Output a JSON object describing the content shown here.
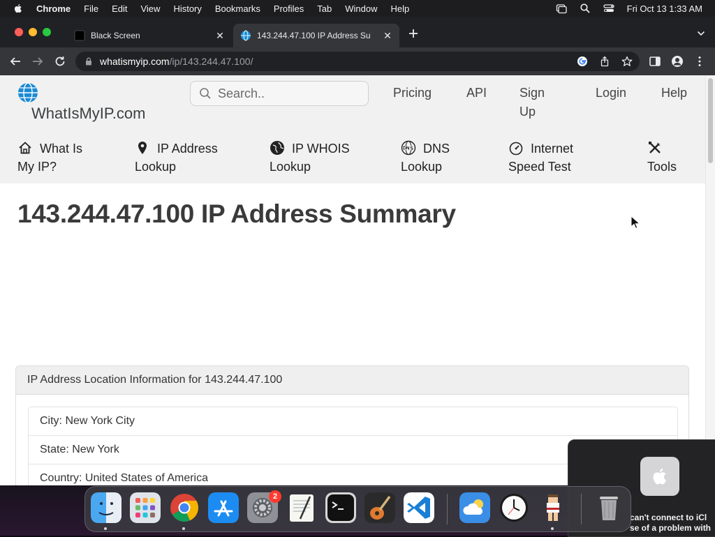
{
  "menubar": {
    "app_name": "Chrome",
    "items": [
      "File",
      "Edit",
      "View",
      "History",
      "Bookmarks",
      "Profiles",
      "Tab",
      "Window",
      "Help"
    ],
    "clock": "Fri Oct 13  1:33 AM"
  },
  "tabs": [
    {
      "title": "Black Screen",
      "active": false
    },
    {
      "title": "143.244.47.100 IP Address Su",
      "active": true
    }
  ],
  "omnibox": {
    "host": "whatismyip.com",
    "path": "/ip/143.244.47.100/"
  },
  "site": {
    "logo_text": "WhatIsMyIP.com",
    "search_placeholder": "Search..",
    "top_nav": {
      "pricing": "Pricing",
      "api": "API",
      "signup_line1": "Sign",
      "signup_line2": "Up",
      "login": "Login",
      "help": "Help"
    },
    "main_nav": {
      "whatismyip_line1": "What Is",
      "whatismyip_line2": "My IP?",
      "iplookup_line1": "IP Address",
      "iplookup_line2": "Lookup",
      "whois_line1": "IP WHOIS",
      "whois_line2": "Lookup",
      "dns_line1": "DNS",
      "dns_line2": "Lookup",
      "speed_line1": "Internet",
      "speed_line2": "Speed Test",
      "tools": "Tools"
    }
  },
  "main": {
    "title": "143.244.47.100 IP Address Summary",
    "location_card": {
      "header": "IP Address Location Information for 143.244.47.100",
      "rows": [
        "City: New York City",
        "State: New York",
        "Country: United States of America"
      ]
    }
  },
  "notification": {
    "text_line1": "can't connect to iCl",
    "text_line2": "se of a problem with"
  },
  "dock": {
    "apps": [
      "finder-icon",
      "launchpad-icon",
      "chrome-icon",
      "app-store-icon",
      "system-settings-icon",
      "textedit-icon",
      "terminal-icon",
      "garageband-icon",
      "vscode-icon",
      "weather-icon",
      "clock-icon",
      "game-character-icon",
      "trash-icon"
    ],
    "settings_badge": "2"
  },
  "colors": {
    "menubar_bg": "#1d1d1f",
    "tabstrip_bg": "#202124",
    "toolbar_bg": "#35363a",
    "site_header_bg": "#f1f1f1",
    "accent_blue": "#1a73e8"
  }
}
